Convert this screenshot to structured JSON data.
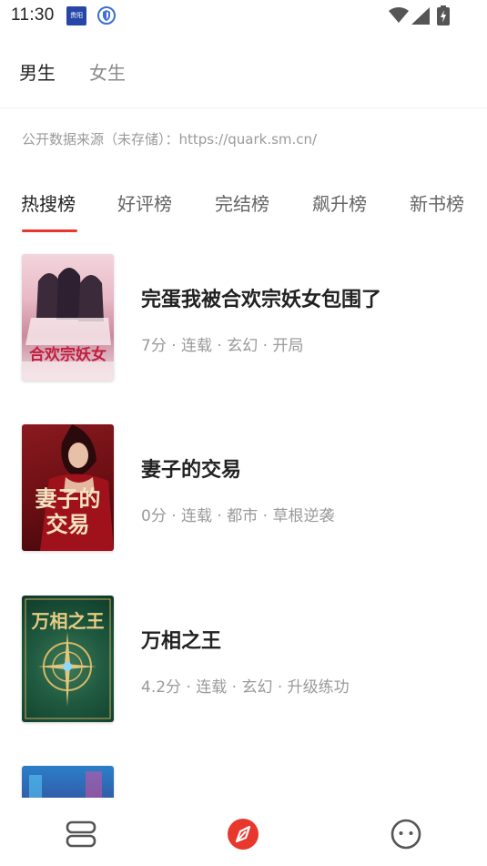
{
  "status_bar": {
    "time": "11:30",
    "app_icon_text": "贵阳",
    "icons": [
      "app-badge-icon",
      "shield-icon",
      "wifi-icon",
      "signal-icon",
      "battery-charging-icon"
    ]
  },
  "gender_tabs": [
    {
      "label": "男生",
      "active": true
    },
    {
      "label": "女生",
      "active": false
    }
  ],
  "source_note": "公开数据来源（未存储）：https://quark.sm.cn/",
  "rank_tabs": [
    {
      "label": "热搜榜",
      "active": true
    },
    {
      "label": "好评榜",
      "active": false
    },
    {
      "label": "完结榜",
      "active": false
    },
    {
      "label": "飙升榜",
      "active": false
    },
    {
      "label": "新书榜",
      "active": false
    }
  ],
  "books": [
    {
      "title": "完蛋我被合欢宗妖女包围了",
      "meta": "7分 · 连载 · 玄幻 · 开局",
      "cover_text": "合欢宗妖女"
    },
    {
      "title": "妻子的交易",
      "meta": "0分 · 连载 · 都市 · 草根逆袭",
      "cover_text": "妻子的交易"
    },
    {
      "title": "万相之王",
      "meta": "4.2分 · 连载 · 玄幻 · 升级练功",
      "cover_text": "万相之王"
    },
    {
      "title": "",
      "meta": "",
      "cover_text": ""
    }
  ],
  "bottom_nav": [
    "bookshelf-icon",
    "discover-compass-icon",
    "profile-face-icon"
  ],
  "colors": {
    "accent": "#e8372c",
    "text": "#222222",
    "muted": "#9a9a9a"
  }
}
